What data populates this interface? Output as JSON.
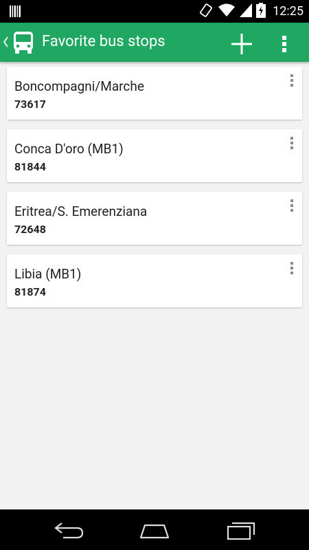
{
  "status_bar": {
    "time": "12:25",
    "icons": [
      "barcode-notification-icon",
      "rotate-icon",
      "wifi-icon",
      "signal-icon",
      "battery-charging-icon"
    ]
  },
  "app_bar": {
    "title": "Favorite bus stops",
    "icons": [
      "back-chevron-icon",
      "bus-icon",
      "add-icon",
      "overflow-menu-icon"
    ],
    "color": "#20a862"
  },
  "stops": [
    {
      "name": "Boncompagni/Marche",
      "code": "73617"
    },
    {
      "name": "Conca D'oro (MB1)",
      "code": "81844"
    },
    {
      "name": "Eritrea/S. Emerenziana",
      "code": "72648"
    },
    {
      "name": "Libia (MB1)",
      "code": "81874"
    }
  ],
  "nav_bar": {
    "icons": [
      "back-icon",
      "home-icon",
      "recent-apps-icon"
    ]
  }
}
